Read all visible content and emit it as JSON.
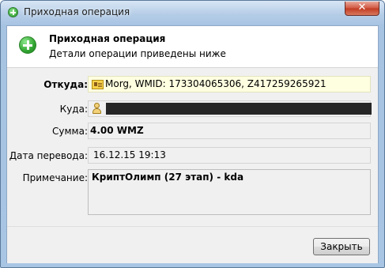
{
  "window": {
    "title": "Приходная операция"
  },
  "header": {
    "title": "Приходная операция",
    "subtitle": "Детали операции приведены ниже"
  },
  "fields": {
    "from": {
      "label": "Откуда:",
      "value": "Morg, WMID: 173304065306, Z417259265921"
    },
    "to": {
      "label": "Куда:",
      "value": ""
    },
    "amount": {
      "label": "Сумма:",
      "value": "4.00 WMZ"
    },
    "date": {
      "label": "Дата перевода:",
      "value": "16.12.15 19:13"
    },
    "note": {
      "label": "Примечание:",
      "value": "КриптОлимп (27 этап) -   kda"
    }
  },
  "footer": {
    "close_label": "Закрыть"
  },
  "icons": {
    "title_icon": "plus-circle-icon",
    "close_icon": "close-icon",
    "header_icon": "plus-circle-icon",
    "from_icon": "wallet-card-icon",
    "to_icon": "user-icon"
  }
}
